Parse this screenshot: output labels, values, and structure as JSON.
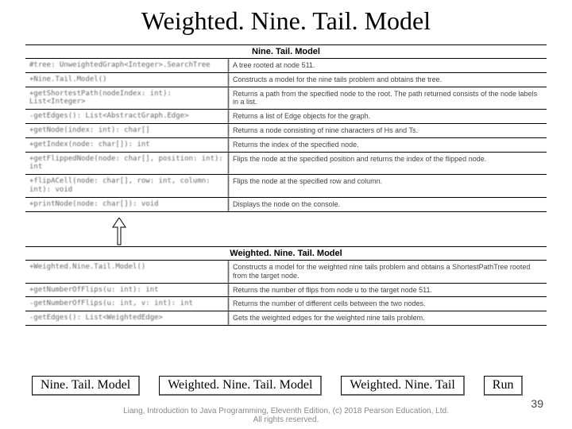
{
  "title": "Weighted. Nine. Tail. Model",
  "uml_top": {
    "header": "Nine. Tail. Model",
    "rows": [
      {
        "left": "#tree: UnweightedGraph<Integer>.SearchTree",
        "right": "A tree rooted at node 511."
      },
      {
        "left": "+Nine.Tail.Model()",
        "right": "Constructs a model for the nine tails problem and obtains the tree."
      },
      {
        "left": "+getShortestPath(nodeIndex: int): List<Integer>",
        "right": "Returns a path from the specified node to the root. The path returned consists of the node labels in a list."
      },
      {
        "left": "-getEdges(): List<AbstractGraph.Edge>",
        "right": "Returns a list of Edge objects for the graph."
      },
      {
        "left": "+getNode(index: int): char[]",
        "right": "Returns a node consisting of nine characters of Hs and Ts."
      },
      {
        "left": "+getIndex(node: char[]): int",
        "right": "Returns the index of the specified node."
      },
      {
        "left": "+getFlippedNode(node: char[], position: int): int",
        "right": "Flips the node at the specified position and returns the index of the flipped node."
      },
      {
        "left": "+flipACell(node: char[], row: int, column: int): void",
        "right": "Flips the node at the specified row and column."
      },
      {
        "left": "+printNode(node: char[]): void",
        "right": "Displays the node on the console."
      }
    ]
  },
  "uml_bottom": {
    "header": "Weighted. Nine. Tail. Model",
    "rows": [
      {
        "left": "+Weighted.Nine.Tail.Model()",
        "right": "Constructs a model for the weighted nine tails problem and obtains a ShortestPathTree rooted from the target node."
      },
      {
        "left": "+getNumberOfFlips(u: int): int",
        "right": "Returns the number of flips from node u to the target node 511."
      },
      {
        "left": "-getNumberOfFlips(u: int, v: int): int",
        "right": "Returns the number of different cells between the two nodes."
      },
      {
        "left": "-getEdges(): List<WeightedEdge>",
        "right": "Gets the weighted edges for the weighted nine tails problem."
      }
    ]
  },
  "links": {
    "l1": "Nine. Tail. Model",
    "l2": "Weighted. Nine. Tail. Model",
    "l3": "Weighted. Nine. Tail",
    "run": "Run"
  },
  "footer": {
    "line1": "Liang, Introduction to Java Programming, Eleventh Edition, (c) 2018 Pearson Education, Ltd.",
    "line2": "All rights reserved."
  },
  "page_number": "39"
}
